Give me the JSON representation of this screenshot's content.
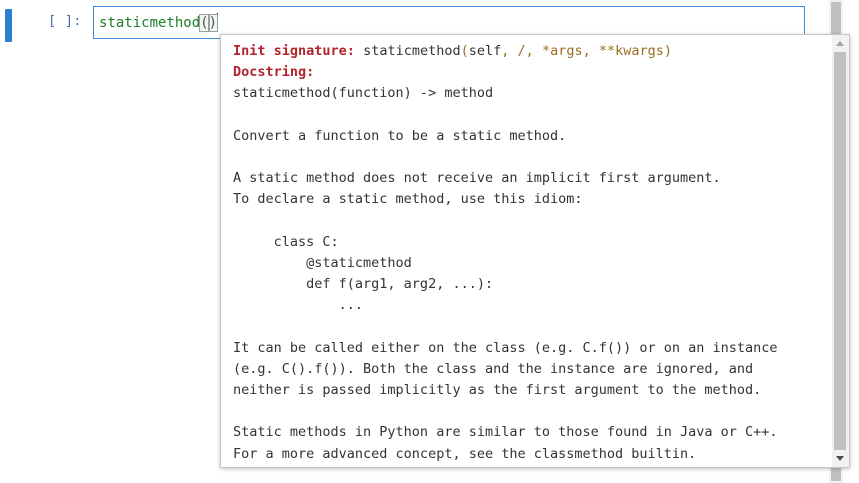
{
  "cell": {
    "prompt": "[ ]:",
    "code_name": "staticmethod",
    "code_open": "(",
    "code_close": ")"
  },
  "tooltip": {
    "init_label": "Init signature:",
    "sig_func": "staticmethod",
    "sig_open": "(",
    "sig_self": "self",
    "sig_c1": ",",
    "sig_slash": " /",
    "sig_c2": ",",
    "sig_args": " *args",
    "sig_c3": ",",
    "sig_kwargs": " **kwargs",
    "sig_close": ")",
    "doc_label": "Docstring:",
    "lines": [
      "staticmethod(function) -> method",
      "",
      "Convert a function to be a static method.",
      "",
      "A static method does not receive an implicit first argument.",
      "To declare a static method, use this idiom:",
      "",
      "     class C:",
      "         @staticmethod",
      "         def f(arg1, arg2, ...):",
      "             ...",
      "",
      "It can be called either on the class (e.g. C.f()) or on an instance",
      "(e.g. C().f()). Both the class and the instance are ignored, and",
      "neither is passed implicitly as the first argument to the method.",
      "",
      "Static methods in Python are similar to those found in Java or C++.",
      "For a more advanced concept, see the classmethod builtin."
    ]
  },
  "colors": {
    "cell_marker": "#2c7fd0",
    "input_border": "#3c8ad6",
    "code_text": "#1a7f25",
    "label_red": "#b3232c",
    "signature_punct": "#9a6c22"
  }
}
